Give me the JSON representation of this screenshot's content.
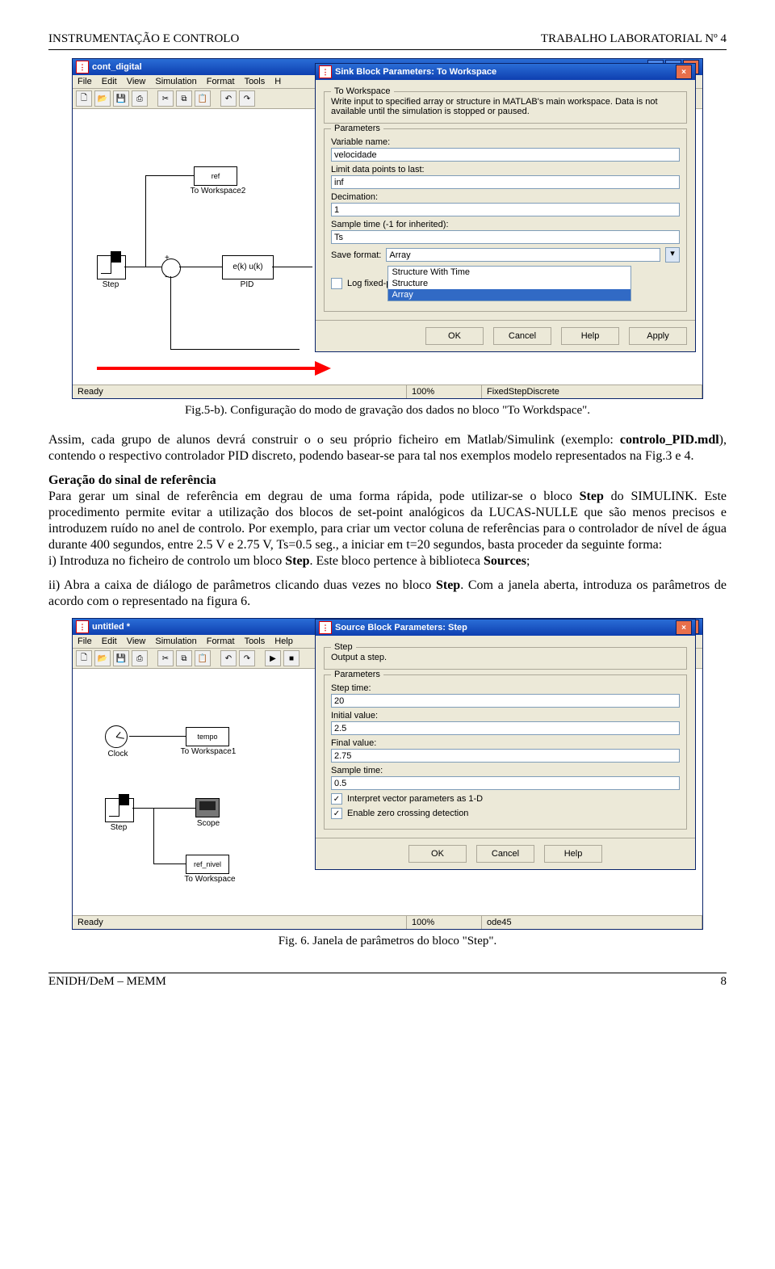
{
  "header": {
    "left": "INSTRUMENTAÇÃO E CONTROLO",
    "right": "TRABALHO LABORATORIAL Nº 4"
  },
  "footer": {
    "left": "ENIDH/DeM – MEMM",
    "right": "8"
  },
  "fig1": {
    "window_title": "cont_digital",
    "menus": [
      "File",
      "Edit",
      "View",
      "Simulation",
      "Format",
      "Tools",
      "H"
    ],
    "status": {
      "ready": "Ready",
      "pct": "100%",
      "solver": "FixedStepDiscrete"
    },
    "blocks": {
      "step_label": "Step",
      "pid_label": "PID",
      "pid_text": "e(k) u(k)",
      "tw2_text": "ref",
      "tw2_label": "To Workspace2"
    },
    "dialog": {
      "title": "Sink Block Parameters: To Workspace",
      "group1_legend": "To Workspace",
      "desc": "Write input to specified array or structure in MATLAB's main workspace. Data is not available until the simulation is stopped or paused.",
      "group2_legend": "Parameters",
      "varname_label": "Variable name:",
      "varname_value": "velocidade",
      "limit_label": "Limit data points to last:",
      "limit_value": "inf",
      "dec_label": "Decimation:",
      "dec_value": "1",
      "ts_label": "Sample time (-1 for inherited):",
      "ts_value": "Ts",
      "save_label": "Save format:",
      "save_value": "Array",
      "log_label": "Log fixed-p",
      "options": [
        "Structure With Time",
        "Structure",
        "Array"
      ],
      "btn_ok": "OK",
      "btn_cancel": "Cancel",
      "btn_help": "Help",
      "btn_apply": "Apply"
    },
    "caption": "Fig.5-b). Configuração do modo de gravação dos dados no bloco \"To Workdspace\"."
  },
  "body": {
    "p1a": "Assim, cada grupo de alunos devrá construir o o seu próprio ficheiro em Matlab/Simulink (exemplo: ",
    "p1b": "controlo_PID.mdl",
    "p1c": "), contendo o respectivo controlador PID discreto, podendo basear-se para tal nos exemplos modelo representados na Fig.3 e 4.",
    "h1": "Geração do sinal de referência",
    "p2a": "Para gerar um sinal de referência em degrau de uma forma rápida, pode utilizar-se o bloco ",
    "p2b": "Step",
    "p2c": " do SIMULINK. Este procedimento permite evitar a utilização dos blocos de set-point analógicos da LUCAS-NULLE que são menos precisos e introduzem ruído no anel de controlo. Por exemplo, para criar um vector coluna de referências para o controlador de nível de água durante 400 segundos, entre 2.5 V e 2.75 V, Ts=0.5 seg., a iniciar em t=20 segundos, basta proceder da seguinte forma:",
    "p3a": "i) Introduza no ficheiro de controlo um bloco ",
    "p3b": "Step",
    "p3c": ". Este bloco pertence à biblioteca ",
    "p3d": "Sources",
    "p3e": ";",
    "p4a": "ii) Abra a caixa de diálogo de parâmetros clicando duas vezes no bloco ",
    "p4b": "Step",
    "p4c": ". Com a janela aberta, introduza os parâmetros de acordo com o representado na figura 6."
  },
  "fig2": {
    "window_title": "untitled *",
    "menus": [
      "File",
      "Edit",
      "View",
      "Simulation",
      "Format",
      "Tools",
      "Help"
    ],
    "status": {
      "ready": "Ready",
      "pct": "100%",
      "solver": "ode45"
    },
    "blocks": {
      "clock_label": "Clock",
      "tw1_text": "tempo",
      "tw1_label": "To Workspace1",
      "step_label": "Step",
      "scope_label": "Scope",
      "tw_text": "ref_nivel",
      "tw_label": "To Workspace"
    },
    "dialog": {
      "title": "Source Block Parameters: Step",
      "group1_legend": "Step",
      "desc": "Output a step.",
      "group2_legend": "Parameters",
      "steptime_label": "Step time:",
      "steptime_value": "20",
      "init_label": "Initial value:",
      "init_value": "2.5",
      "final_label": "Final value:",
      "final_value": "2.75",
      "ts_label": "Sample time:",
      "ts_value": "0.5",
      "check1": "Interpret vector parameters as 1-D",
      "check2": "Enable zero crossing detection",
      "btn_ok": "OK",
      "btn_cancel": "Cancel",
      "btn_help": "Help"
    },
    "caption": "Fig. 6. Janela de parâmetros do bloco \"Step\"."
  }
}
